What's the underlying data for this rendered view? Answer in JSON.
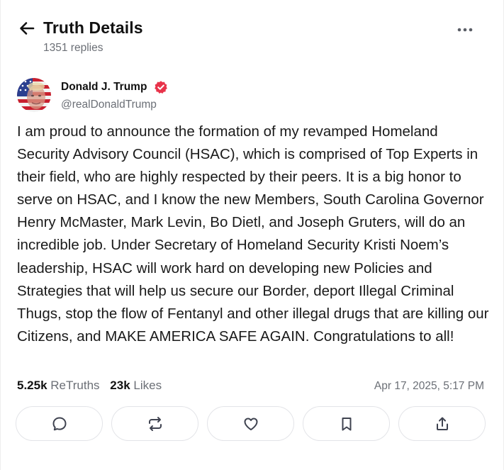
{
  "header": {
    "title": "Truth Details",
    "replies": "1351 replies"
  },
  "post": {
    "author_name": "Donald J. Trump",
    "handle": "@realDonaldTrump",
    "text": "I am proud to announce the formation of my revamped Homeland Security Advisory Council (HSAC), which is comprised of Top Experts in their field, who are highly respected by their peers. It is a big honor to serve on HSAC, and I know the new Members, South Carolina Governor Henry McMaster, Mark Levin, Bo Dietl, and Joseph Gruters, will do an incredible job. Under Secretary of Homeland Security Kristi Noem’s leadership, HSAC will work hard on developing new Policies and Strategies that will help us secure our Border, deport Illegal Criminal Thugs, stop the flow of Fentanyl and other illegal drugs that are killing our Citizens, and MAKE AMERICA SAFE AGAIN. Congratulations to all!",
    "retruths_count": "5.25k",
    "retruths_label": "ReTruths",
    "likes_count": "23k",
    "likes_label": "Likes",
    "timestamp": "Apr 17, 2025, 5:17 PM"
  },
  "actions": [
    "reply",
    "retruth",
    "like",
    "bookmark",
    "share"
  ],
  "icons": {
    "back": "arrow-left-icon",
    "more": "more-horizontal-icon",
    "verified": "verified-badge-icon",
    "reply": "comment-bubble-icon",
    "retruth": "repost-icon",
    "like": "heart-icon",
    "bookmark": "bookmark-icon",
    "share": "share-icon"
  },
  "colors": {
    "verified": "#E8334A",
    "muted_text": "#6b6f76",
    "action_border": "#e3e4e8",
    "icon": "#3f4350"
  }
}
